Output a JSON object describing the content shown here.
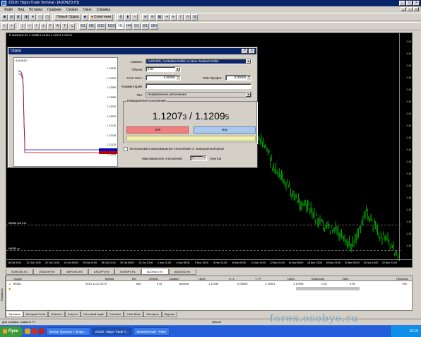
{
  "window": {
    "title": "23320: Hippo-Trade Terminal - [AUDNZD,H1]",
    "controls": [
      "_",
      "□",
      "×"
    ]
  },
  "menu": [
    "Файл",
    "Вид",
    "Вставка",
    "Графики",
    "Сервис",
    "Окно",
    "Справка"
  ],
  "toolbar": {
    "new_order": "Новый Ордер",
    "experts": "Советники",
    "timeframes": [
      "M1",
      "M5",
      "M15",
      "M30",
      "H1",
      "H4",
      "D1",
      "W1",
      "MN"
    ]
  },
  "chart": {
    "header": "▼ AUDNZD,H1  1.12089 1.12144 1.12072 1.12074",
    "price_ticks": [
      "1.14",
      "1.14",
      "1.14",
      "1.14",
      "1.14",
      "1.14",
      "1.14",
      "1.14",
      "1.14",
      "1.14",
      "1.14",
      "1.14",
      "1.13",
      "1.13",
      "1.12",
      "1.12",
      "1.12",
      "1.12"
    ],
    "time_ticks": [
      "18 Oct 2013",
      "21 Oct 13:00",
      "22 Oct 21:00",
      "24 Oct 05:00",
      "25 Oct 13:00",
      "28 Oct 21:00",
      "30 Oct 05:00",
      "31 Oct 13:00",
      "1 Nov 21:00",
      "4 Nov 05:00",
      "5 Nov 13:00",
      "6 Nov 21:00",
      "8 Nov 05:00",
      "11 Nov 13:00",
      "12 Nov 21:00",
      "14 Nov 05:00",
      "15 Nov 13:00",
      "18 Nov 21:00",
      "20 Nov 05:00",
      "21 Nov 13:00",
      "22 Nov 21:00"
    ],
    "order_lines": [
      "#89281 sell 0.01",
      "#89281 tp"
    ],
    "candles_color": "#00a000"
  },
  "chart_tabs": [
    "EURUSD,H1",
    "USDCHF,H4",
    "GBPUSD,H4",
    "USDJPY,H4",
    "EURJPY,H1",
    "AUDNZD,H1",
    "AUDUSD,H1"
  ],
  "chart_tabs_active": 5,
  "terminal": {
    "columns": [
      "Ордер",
      "Время",
      "Тип",
      "Объём",
      "Символ",
      "Цена",
      "S / L",
      "T / P",
      "Цена",
      "Комиссия",
      "Своп",
      "Прибыль"
    ],
    "rows": [
      [
        "89281",
        "2013.11.22 20:07",
        "sell",
        "0.01",
        "audnzd",
        "1.12290",
        "0.00000",
        "1.11801",
        "1.12095",
        "-0.01",
        "0.00",
        "195"
      ]
    ],
    "side_label": "Терминал"
  },
  "bottom_tabs": [
    "Торговля",
    "История Счета",
    "Новости",
    "Алерты",
    "Почтовый ящик",
    "Сигналы",
    "Code Base",
    "Эксперты",
    "Журнал"
  ],
  "bottom_tabs_active": 0,
  "status": {
    "help": "Для справки, нажмите F1",
    "profile": "Default"
  },
  "watermark": "forex.osobye.ru",
  "taskbar": {
    "start": "Пуск",
    "tasks": [
      "Выбор брокера с безде...",
      "23320: Hippo-Trade T...",
      "Безымянный - Paint"
    ],
    "active_task": 1,
    "clock": "15:18"
  },
  "dialog": {
    "title": "Ордер",
    "mini_chart_label": "AUDNZD",
    "mini_ticks": [
      "1.12330",
      "1.12303",
      "1.12286",
      "1.12258",
      "1.12230",
      "1.12203",
      "1.12176",
      "1.12149",
      "1.12123",
      "1.12095"
    ],
    "symbol_label": "Символ:",
    "symbol_value": "AUDNZD, Australian Dollar vs New Zealand Dollar",
    "volume_label": "Объем:",
    "volume_value": "0.01",
    "stoploss_label": "Стоп Лосс:",
    "stoploss_value": "0.00000",
    "takeprofit_label": "Тейк Профит:",
    "takeprofit_value": "0.00000",
    "comment_label": "Комментарий:",
    "comment_value": "",
    "type_label": "Тип:",
    "type_value": "Немедленное исполнение",
    "exec_group": "Немедленное исполнение",
    "bid": "1.1207",
    "bid_small": "3",
    "ask": "1.1209",
    "ask_small": "5",
    "quote_sep": " / ",
    "sell_label": "Sell",
    "buy_label": "Buy",
    "deviation_checkbox": "Использовать максимальное отклонение от запрошенной цены",
    "max_dev_label": "Максимальное отклонение:",
    "max_dev_value": "0",
    "max_dev_unit": "пунктов"
  }
}
